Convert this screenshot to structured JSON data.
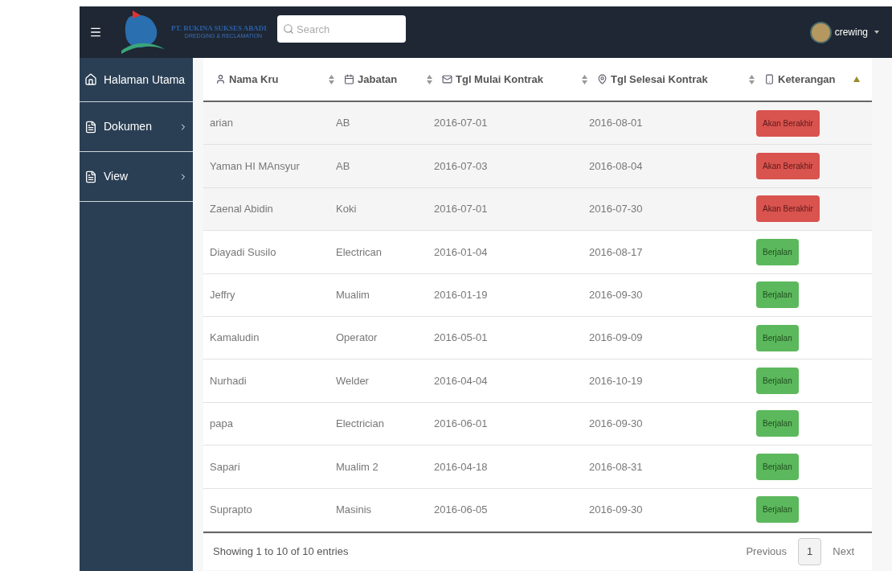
{
  "header": {
    "company": "PT. RUKINA SUKSES ABADI",
    "tagline": "DREDGING & RECLAMATION",
    "search": {
      "placeholder": "Search"
    },
    "user": "crewing"
  },
  "sidebar": {
    "items": [
      {
        "label": "Halaman Utama",
        "has_submenu": false
      },
      {
        "label": "Dokumen",
        "has_submenu": true
      },
      {
        "label": "View",
        "has_submenu": true
      }
    ]
  },
  "table": {
    "columns": [
      {
        "label": "Nama Kru",
        "sorted_ascending": false
      },
      {
        "label": "Jabatan",
        "sorted_ascending": false
      },
      {
        "label": "Tgl Mulai Kontrak",
        "sorted_ascending": false
      },
      {
        "label": "Tgl Selesai Kontrak",
        "sorted_ascending": false
      },
      {
        "label": "Keterangan",
        "sorted_ascending": true
      }
    ],
    "rows": [
      {
        "cells": [
          "arian",
          "AB",
          "2016-07-01",
          "2016-08-01"
        ],
        "status": {
          "label": "Akan Berakhir",
          "kind": "ending"
        }
      },
      {
        "cells": [
          "Yaman HI MAnsyur",
          "AB",
          "2016-07-03",
          "2016-08-04"
        ],
        "status": {
          "label": "Akan Berakhir",
          "kind": "ending"
        }
      },
      {
        "cells": [
          "Zaenal Abidin",
          "Koki",
          "2016-07-01",
          "2016-07-30"
        ],
        "status": {
          "label": "Akan Berakhir",
          "kind": "ending"
        }
      },
      {
        "cells": [
          "Diayadi Susilo",
          "Electrican",
          "2016-01-04",
          "2016-08-17"
        ],
        "status": {
          "label": "Berjalan",
          "kind": "running"
        }
      },
      {
        "cells": [
          "Jeffry",
          "Mualim",
          "2016-01-19",
          "2016-09-30"
        ],
        "status": {
          "label": "Berjalan",
          "kind": "running"
        }
      },
      {
        "cells": [
          "Kamaludin",
          "Operator",
          "2016-05-01",
          "2016-09-09"
        ],
        "status": {
          "label": "Berjalan",
          "kind": "running"
        }
      },
      {
        "cells": [
          "Nurhadi",
          "Welder",
          "2016-04-04",
          "2016-10-19"
        ],
        "status": {
          "label": "Berjalan",
          "kind": "running"
        }
      },
      {
        "cells": [
          "papa",
          "Electrician",
          "2016-06-01",
          "2016-09-30"
        ],
        "status": {
          "label": "Berjalan",
          "kind": "running"
        }
      },
      {
        "cells": [
          "Sapari",
          "Mualim 2",
          "2016-04-18",
          "2016-08-31"
        ],
        "status": {
          "label": "Berjalan",
          "kind": "running"
        }
      },
      {
        "cells": [
          "Suprapto",
          "Masinis",
          "2016-06-05",
          "2016-09-30"
        ],
        "status": {
          "label": "Berjalan",
          "kind": "running"
        }
      }
    ],
    "info": "Showing 1 to 10 of 10 entries",
    "pagination": [
      {
        "label": "Previous",
        "selected": false
      },
      {
        "label": "1",
        "selected": true
      },
      {
        "label": "Next",
        "selected": false
      }
    ]
  }
}
